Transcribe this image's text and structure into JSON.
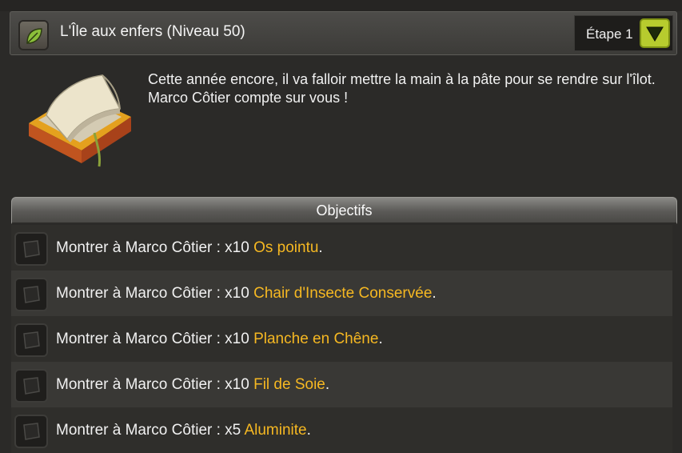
{
  "quest": {
    "title": "L'Île aux enfers (Niveau 50)",
    "step_label": "Étape 1",
    "description": "Cette année encore, il va falloir mettre la main à la pâte pour se rendre sur l'îlot. Marco Côtier compte sur vous !"
  },
  "objectives": {
    "header": "Objectifs",
    "items": [
      {
        "prefix": "Montrer à Marco Côtier : x10 ",
        "item": "Os pointu",
        "suffix": "."
      },
      {
        "prefix": "Montrer à Marco Côtier : x10 ",
        "item": "Chair d'Insecte Conservée",
        "suffix": "."
      },
      {
        "prefix": "Montrer à Marco Côtier : x10 ",
        "item": "Planche en Chêne",
        "suffix": "."
      },
      {
        "prefix": "Montrer à Marco Côtier : x10 ",
        "item": "Fil de Soie",
        "suffix": "."
      },
      {
        "prefix": "Montrer à Marco Côtier : x5 ",
        "item": "Aluminite",
        "suffix": "."
      }
    ]
  },
  "icons": {
    "quest": "leaf-icon",
    "toggle": "triangle-down-icon",
    "book": "book-icon",
    "objective_check": "unchecked-box-icon"
  },
  "colors": {
    "item_highlight": "#f6b822",
    "toggle_accent": "#b7cc2e"
  }
}
